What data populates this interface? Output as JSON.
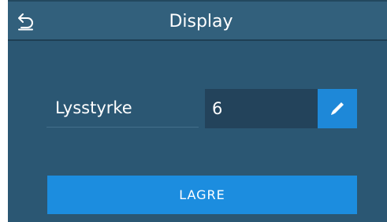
{
  "header": {
    "title": "Display",
    "back_icon": "back-arrow-icon"
  },
  "setting": {
    "label": "Lysstyrke",
    "value": "6",
    "edit_icon": "pencil-icon"
  },
  "actions": {
    "save_label": "LAGRE"
  },
  "colors": {
    "background": "#2b5773",
    "header": "#32607c",
    "value_field": "#23435b",
    "accent": "#1c8ddf"
  }
}
